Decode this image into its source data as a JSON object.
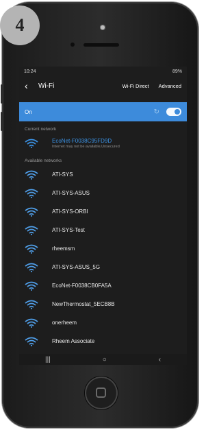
{
  "badge": "4",
  "status": {
    "time": "10:24",
    "battery": "89%"
  },
  "header": {
    "title": "Wi-Fi",
    "wifi_direct": "Wi-Fi Direct",
    "advanced": "Advanced"
  },
  "toggle_row": {
    "label": "On"
  },
  "current_section": "Current network",
  "current_network": {
    "name": "EcoNet-F0038C95FD9D",
    "status": "Internet may not be available,Unsecured"
  },
  "available_section": "Available networks",
  "networks": [
    "ATI-SYS",
    "ATI-SYS-ASUS",
    "ATI-SYS-ORBI",
    "ATI-SYS-Test",
    "rheemsm",
    "ATI-SYS-ASUS_5G",
    "EcoNet-F0038CB0FA5A",
    "NewThermostat_5ECB8B",
    "onerheem",
    "Rheem Associate"
  ],
  "colors": {
    "accent": "#3d8bdb",
    "current_name": "#3b92e4",
    "background": "#1d1d1d"
  },
  "icons": [
    "back-arrow-icon",
    "wifi-icon",
    "toggle-icon",
    "recents-icon",
    "home-icon",
    "back-icon"
  ]
}
